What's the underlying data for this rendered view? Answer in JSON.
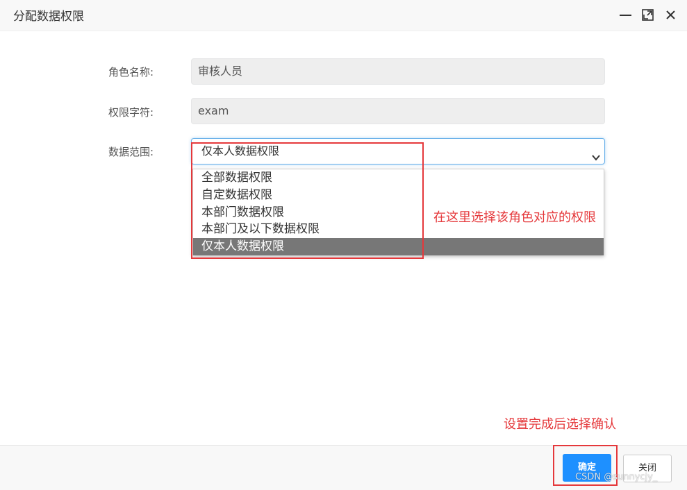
{
  "dialog": {
    "title": "分配数据权限",
    "controls": [
      "minimize-icon",
      "maximize-icon",
      "close-icon"
    ]
  },
  "form": {
    "role_name_label": "角色名称:",
    "role_name_value": "审核人员",
    "role_key_label": "权限字符:",
    "role_key_value": "exam",
    "data_scope_label": "数据范围:",
    "data_scope_selected": "仅本人数据权限",
    "data_scope_options": [
      "全部数据权限",
      "自定数据权限",
      "本部门数据权限",
      "本部门及以下数据权限",
      "仅本人数据权限"
    ],
    "data_scope_highlighted_index": 4
  },
  "annotations": {
    "select_hint": "在这里选择该角色对应的权限",
    "confirm_hint": "设置完成后选择确认",
    "color": "#e5383b"
  },
  "footer": {
    "confirm_label": "确定",
    "close_label": "关闭"
  },
  "watermark": "CSDN @sunnycjy_",
  "colors": {
    "primary": "#1e90ff",
    "selected_option_bg": "#777777",
    "focus_border": "#66afe9"
  }
}
